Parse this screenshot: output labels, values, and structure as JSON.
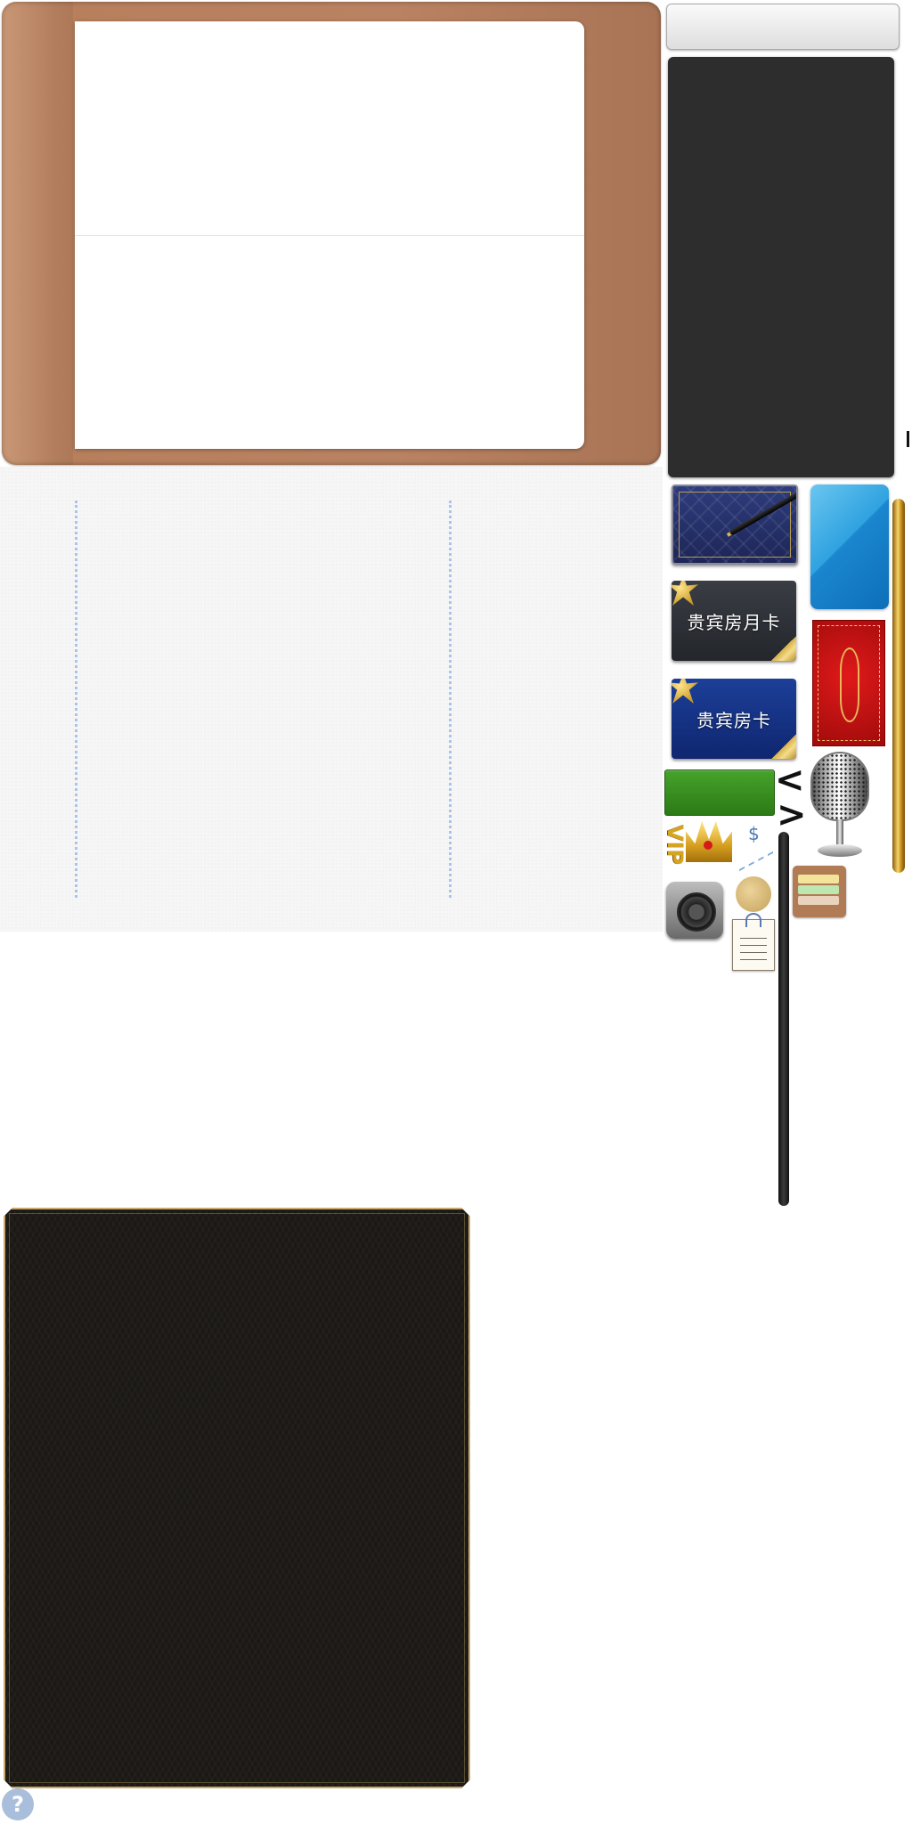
{
  "cards": {
    "monthly_label": "贵宾房月卡",
    "guest_label": "贵宾房卡"
  },
  "vip": {
    "label": "VIP"
  },
  "chart_widget": {
    "currency_symbol": "$"
  },
  "navigation": {
    "prev_glyph": "<",
    "next_glyph": ">"
  },
  "help": {
    "glyph": "?"
  },
  "colors": {
    "leather": "#b98262",
    "ruled_line": "#a8c4ec",
    "dark_panel": "#2d2d2d",
    "green_button": "#3a8f22",
    "gold": "#d6a423",
    "card_blue": "#1a86cf",
    "card_red": "#c01212",
    "frame_gold": "#c9a96b"
  },
  "icons": [
    "pen-icon",
    "bow-icon",
    "microphone-icon",
    "crown-icon",
    "trend-chart-icon",
    "safe-icon",
    "seal-icon",
    "wallet-icon",
    "memo-icon",
    "help-icon"
  ]
}
